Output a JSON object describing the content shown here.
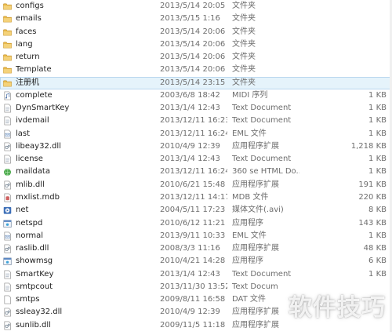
{
  "files": [
    {
      "name": "configs",
      "date": "2013/5/14 20:05",
      "type": "文件夹",
      "size": "",
      "icon": "folder-icon"
    },
    {
      "name": "emails",
      "date": "2013/5/15 1:16",
      "type": "文件夹",
      "size": "",
      "icon": "folder-icon"
    },
    {
      "name": "faces",
      "date": "2013/5/14 20:06",
      "type": "文件夹",
      "size": "",
      "icon": "folder-icon"
    },
    {
      "name": "lang",
      "date": "2013/5/14 20:06",
      "type": "文件夹",
      "size": "",
      "icon": "folder-icon"
    },
    {
      "name": "return",
      "date": "2013/5/14 20:06",
      "type": "文件夹",
      "size": "",
      "icon": "folder-icon"
    },
    {
      "name": "Template",
      "date": "2013/5/14 20:06",
      "type": "文件夹",
      "size": "",
      "icon": "folder-icon"
    },
    {
      "name": "注册机",
      "date": "2013/5/14 23:15",
      "type": "文件夹",
      "size": "",
      "icon": "folder-icon",
      "selected": true
    },
    {
      "name": "complete",
      "date": "2003/6/8 18:42",
      "type": "MIDI 序列",
      "size": "1 KB",
      "icon": "midi-file-icon"
    },
    {
      "name": "DynSmartKey",
      "date": "2013/1/4 12:43",
      "type": "Text Document",
      "size": "1 KB",
      "icon": "text-file-icon"
    },
    {
      "name": "ivdemail",
      "date": "2013/12/11 16:23",
      "type": "Text Document",
      "size": "1 KB",
      "icon": "text-file-icon"
    },
    {
      "name": "last",
      "date": "2013/12/11 16:24",
      "type": "EML 文件",
      "size": "1 KB",
      "icon": "eml-file-icon"
    },
    {
      "name": "libeay32.dll",
      "date": "2010/4/9 12:39",
      "type": "应用程序扩展",
      "size": "1,218 KB",
      "icon": "dll-file-icon"
    },
    {
      "name": "license",
      "date": "2013/1/4 12:43",
      "type": "Text Document",
      "size": "1 KB",
      "icon": "text-file-icon"
    },
    {
      "name": "maildata",
      "date": "2013/12/11 16:24",
      "type": "360 se HTML Do...",
      "size": "1 KB",
      "icon": "html-file-icon"
    },
    {
      "name": "mlib.dll",
      "date": "2010/6/21 15:48",
      "type": "应用程序扩展",
      "size": "191 KB",
      "icon": "dll-file-icon"
    },
    {
      "name": "mxlist.mdb",
      "date": "2013/12/11 14:17",
      "type": "MDB 文件",
      "size": "220 KB",
      "icon": "mdb-file-icon"
    },
    {
      "name": "net",
      "date": "2004/5/11 17:23",
      "type": "媒体文件(.avi)",
      "size": "8 KB",
      "icon": "media-file-icon"
    },
    {
      "name": "netspd",
      "date": "2010/6/12 11:21",
      "type": "应用程序",
      "size": "143 KB",
      "icon": "exe-file-icon"
    },
    {
      "name": "normal",
      "date": "2013/9/11 10:33",
      "type": "EML 文件",
      "size": "1 KB",
      "icon": "eml-file-icon"
    },
    {
      "name": "raslib.dll",
      "date": "2008/3/3 11:16",
      "type": "应用程序扩展",
      "size": "48 KB",
      "icon": "dll-file-icon"
    },
    {
      "name": "showmsg",
      "date": "2010/4/21 14:28",
      "type": "应用程序",
      "size": "6 KB",
      "icon": "exe-file-icon"
    },
    {
      "name": "SmartKey",
      "date": "2013/1/4 12:43",
      "type": "Text Document",
      "size": "1 KB",
      "icon": "text-file-icon"
    },
    {
      "name": "smtpcout",
      "date": "2013/11/30 13:52",
      "type": "Text Docum",
      "size": "",
      "icon": "text-file-icon"
    },
    {
      "name": "smtps",
      "date": "2009/8/11 16:58",
      "type": "DAT 文件",
      "size": "",
      "icon": "dat-file-icon"
    },
    {
      "name": "ssleay32.dll",
      "date": "2010/4/9 12:39",
      "type": "应用程序扩展",
      "size": "",
      "icon": "dll-file-icon"
    },
    {
      "name": "sunlib.dll",
      "date": "2009/11/5 11:18",
      "type": "应用程序扩展",
      "size": "",
      "icon": "dll-file-icon"
    }
  ],
  "watermark": "软件技巧",
  "colors": {
    "folder": "#e8b84a",
    "selection": "#e5f3fb"
  }
}
